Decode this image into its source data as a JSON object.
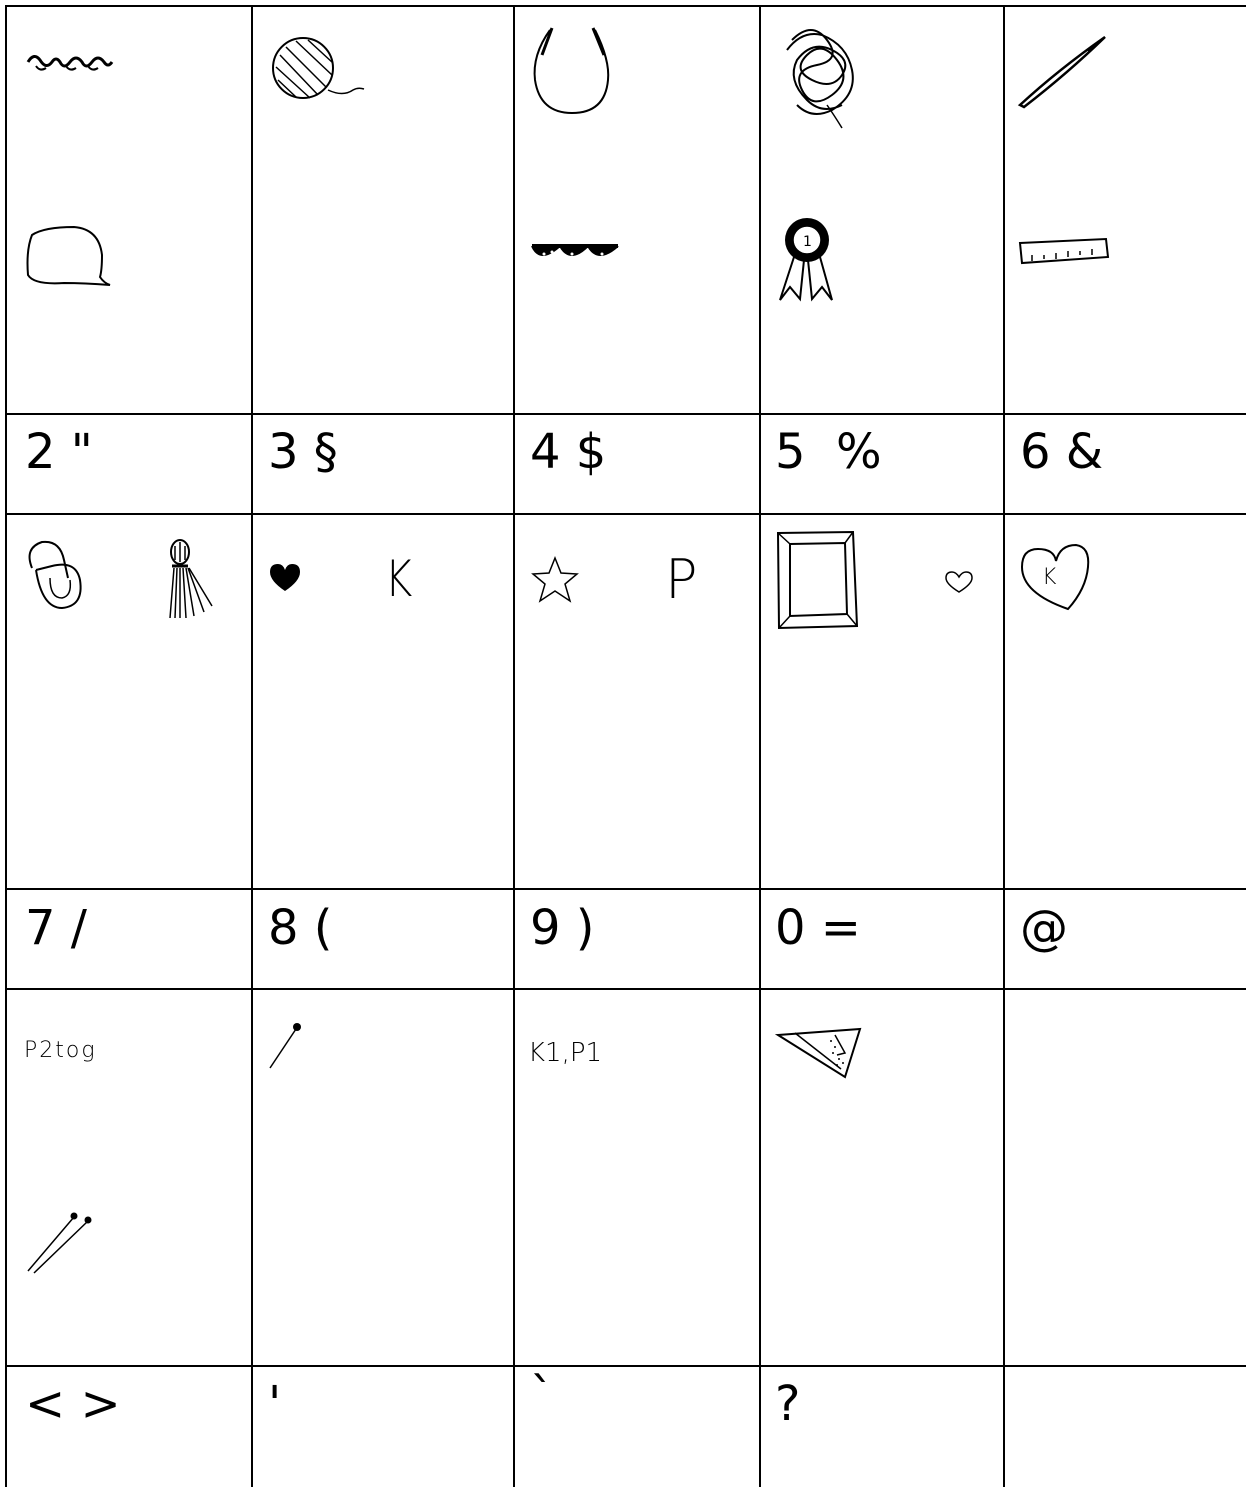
{
  "labels": {
    "r2c1": "2 \"",
    "r2c2": "3 §",
    "r2c3": "4 $",
    "r2c4": "5  %",
    "r2c5": "6 &",
    "r4c1": "7 /",
    "r4c2": "8 (",
    "r4c3": "9 )",
    "r4c4": "0 =",
    "r4c5": "@",
    "r6c1": "< >",
    "r6c2": "'",
    "r6c3": "`",
    "r6c4": "?",
    "r6c5": ""
  },
  "glyph_text": {
    "k_letter": "K",
    "p_letter": "P",
    "heart_k": "K",
    "p2tog": "P2tog",
    "k1p1": "K1,P1"
  },
  "colors": {
    "line": "#000000",
    "background": "#ffffff"
  }
}
